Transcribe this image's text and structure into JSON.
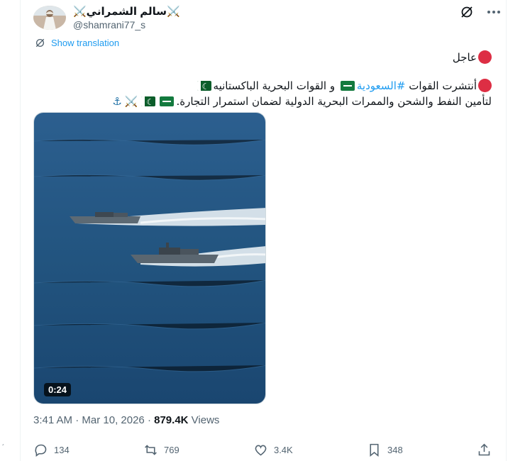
{
  "post": {
    "author": {
      "display_name": "⚔️سالم الشمراني⚔️",
      "handle": "@shamrani77_s"
    },
    "header_icons": [
      "grok-icon",
      "more-icon"
    ],
    "show_translation": "Show translation",
    "text": {
      "line1": "عاجل",
      "line2_part1": "أنتشرت القوات ",
      "line2_hashtag": "#السعودية",
      "line2_part2": " و القوات البحرية الباكستانيه",
      "line3": "لتأمين النفط والشحن والممرات البحرية الدولية لضمان استمرار التجارة."
    },
    "media": {
      "duration": "0:24"
    },
    "meta": {
      "time": "3:41 AM",
      "separator": " · ",
      "date": "Mar 10, 2026",
      "views_count": "879.4K",
      "views_label": " Views"
    },
    "actions": {
      "replies": "134",
      "reposts": "769",
      "likes": "3.4K",
      "bookmarks": "348"
    },
    "colors": {
      "link": "#1d9bf0",
      "secondary_text": "#536471",
      "red_circle": "#dd2e44"
    }
  }
}
